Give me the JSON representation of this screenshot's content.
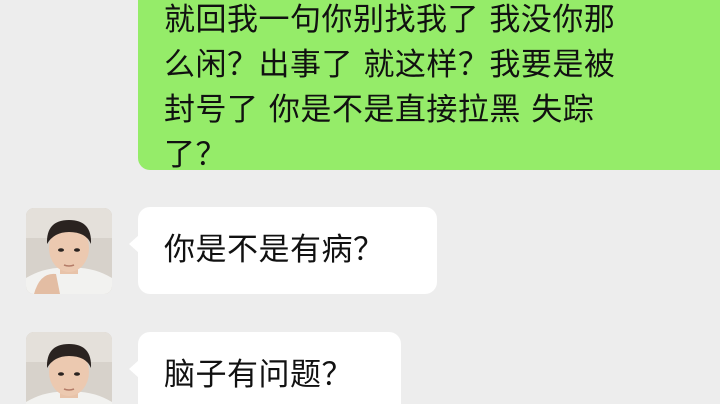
{
  "sent_message": {
    "lines": [
      "就回我一句你别找我了 我没你那",
      "么闲？出事了 就这样？我要是被",
      "封号了 你是不是直接拉黑 失踪",
      "了？"
    ]
  },
  "received_messages": [
    {
      "text": "你是不是有病？"
    },
    {
      "text": "脑子有问题？"
    }
  ],
  "colors": {
    "background": "#ededed",
    "sent_bubble": "#95ec69",
    "received_bubble": "#ffffff",
    "text": "#111111"
  }
}
